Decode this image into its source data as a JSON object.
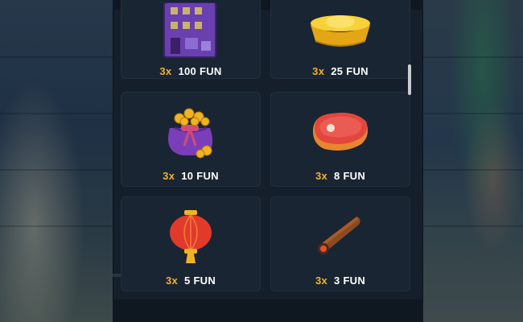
{
  "paytable": {
    "rows": [
      {
        "symbol": "purple-building",
        "multiplier": "3x",
        "payout": "100 FUN"
      },
      {
        "symbol": "gold-ingots",
        "multiplier": "3x",
        "payout": "25 FUN"
      },
      {
        "symbol": "coin-bag",
        "multiplier": "3x",
        "payout": "10 FUN"
      },
      {
        "symbol": "steak",
        "multiplier": "3x",
        "payout": "8 FUN"
      },
      {
        "symbol": "red-lantern",
        "multiplier": "3x",
        "payout": "5 FUN"
      },
      {
        "symbol": "cigar",
        "multiplier": "3x",
        "payout": "3 FUN"
      }
    ]
  },
  "colors": {
    "multiplier": "#f0b323",
    "payout": "#ffffff",
    "panel": "#151f2b",
    "cell": "#1a2533"
  }
}
